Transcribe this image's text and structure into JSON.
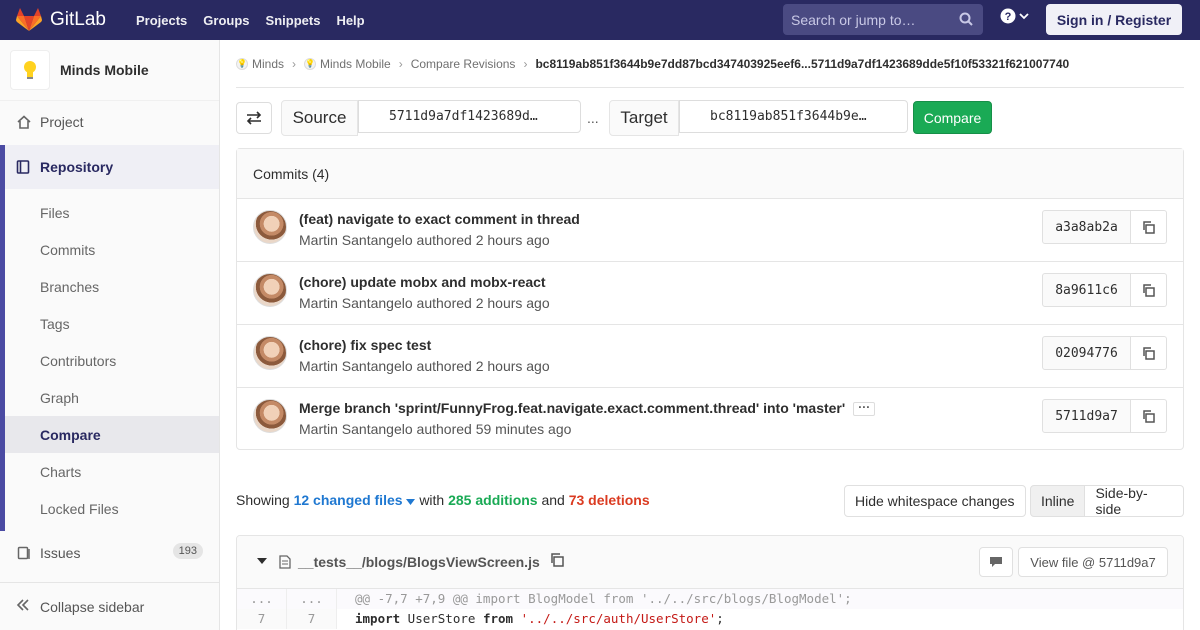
{
  "navbar": {
    "brand": "GitLab",
    "links": [
      "Projects",
      "Groups",
      "Snippets",
      "Help"
    ],
    "search_placeholder": "Search or jump to…",
    "signin_label": "Sign in / Register",
    "colors": {
      "bg": "#292961",
      "logo": "#fc6d26"
    }
  },
  "sidebar": {
    "project_name": "Minds Mobile",
    "project_label": "Project",
    "repository_label": "Repository",
    "repo_items": [
      "Files",
      "Commits",
      "Branches",
      "Tags",
      "Contributors",
      "Graph",
      "Compare",
      "Charts",
      "Locked Files"
    ],
    "active_item": "Compare",
    "issues_label": "Issues",
    "issues_count": "193",
    "collapse_label": "Collapse sidebar"
  },
  "breadcrumb": {
    "items": [
      "Minds",
      "Minds Mobile",
      "Compare Revisions"
    ],
    "current": "bc8119ab851f3644b9e7dd87bcd347403925eef6...5711d9a7df1423689dde5f10f53321f621007740"
  },
  "compare": {
    "source_label": "Source",
    "source_value": "5711d9a7df1423689d…",
    "separator": "...",
    "target_label": "Target",
    "target_value": "bc8119ab851f3644b9e…",
    "button_label": "Compare"
  },
  "commits": {
    "header": "Commits (4)",
    "list": [
      {
        "title": "(feat) navigate to exact comment in thread",
        "author": "Martin Santangelo",
        "meta": "authored 2 hours ago",
        "sha": "a3a8ab2a"
      },
      {
        "title": "(chore) update mobx and mobx-react",
        "author": "Martin Santangelo",
        "meta": "authored 2 hours ago",
        "sha": "8a9611c6"
      },
      {
        "title": "(chore) fix spec test",
        "author": "Martin Santangelo",
        "meta": "authored 2 hours ago",
        "sha": "02094776"
      },
      {
        "title": "Merge branch 'sprint/FunnyFrog.feat.navigate.exact.comment.thread' into 'master'",
        "author": "Martin Santangelo",
        "meta": "authored 59 minutes ago",
        "sha": "5711d9a7"
      }
    ]
  },
  "stats": {
    "showing": "Showing",
    "changed_files": "12 changed files",
    "with": "with",
    "additions": "285 additions",
    "and": "and",
    "deletions": "73 deletions"
  },
  "toolbar": {
    "hide_whitespace": "Hide whitespace changes",
    "inline": "Inline",
    "side_by_side": "Side-by-side"
  },
  "file": {
    "path": "__tests__/blogs/BlogsViewScreen.js",
    "view_file": "View file @ 5711d9a7",
    "hunk_ln_old": "...",
    "hunk_ln_new": "...",
    "hunk": "@@ -7,7 +7,9 @@ import BlogModel from '../../src/blogs/BlogModel';",
    "line_old": "7",
    "line_new": "7",
    "code_kw1": "import",
    "code_id": " UserStore ",
    "code_kw2": "from",
    "code_str": " '../../src/auth/UserStore'",
    "code_end": ";"
  }
}
